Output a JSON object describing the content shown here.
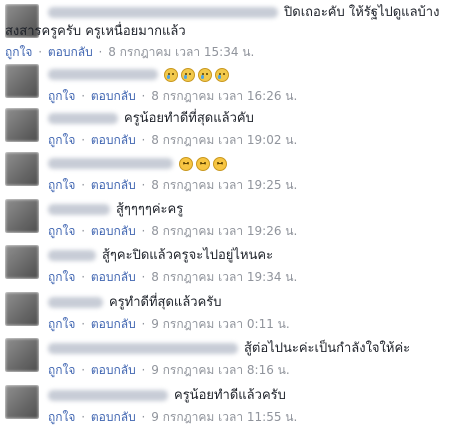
{
  "meta_labels": {
    "like": "ถูกใจ",
    "reply": "ตอบกลับ",
    "sep": "·"
  },
  "comments": [
    {
      "text": "ปิดเถอะคับ ให้รัฐไปดูแลบ้าง",
      "text2": "สงสารครูครับ ครูเหนื่อยมากแล้ว",
      "time": "8 กรกฎาคม เวลา 15:34 น."
    },
    {
      "text": "",
      "emojis": [
        "cry",
        "cry",
        "cry",
        "cry"
      ],
      "time": "8 กรกฎาคม เวลา 16:26 น."
    },
    {
      "text": "ครูน้อยทำดีที่สุดแล้วคับ",
      "time": "8 กรกฎาคม เวลา 19:02 น."
    },
    {
      "text": "",
      "emojis": [
        "sad",
        "sad",
        "sad"
      ],
      "time": "8 กรกฎาคม เวลา 19:25 น."
    },
    {
      "text": "สู้ๆๆๆๆค่ะครู",
      "time": "8 กรกฎาคม เวลา 19:26 น."
    },
    {
      "text": "สู้ๆคะปิดแล้วครูจะไปอยู่ไหนคะ",
      "time": "8 กรกฎาคม เวลา 19:34 น."
    },
    {
      "text": "ครูทำดีที่สุดแล้วครับ",
      "time": "9 กรกฎาคม เวลา 0:11 น."
    },
    {
      "text": "สู้ต่อไปนะค่ะเป็นกำลังใจให้ค่ะ",
      "time": "9 กรกฎาคม เวลา 8:16 น."
    },
    {
      "text": "ครูน้อยทำดีแล้วครับ",
      "time": "9 กรกฎาคม เวลา 11:55 น."
    }
  ]
}
